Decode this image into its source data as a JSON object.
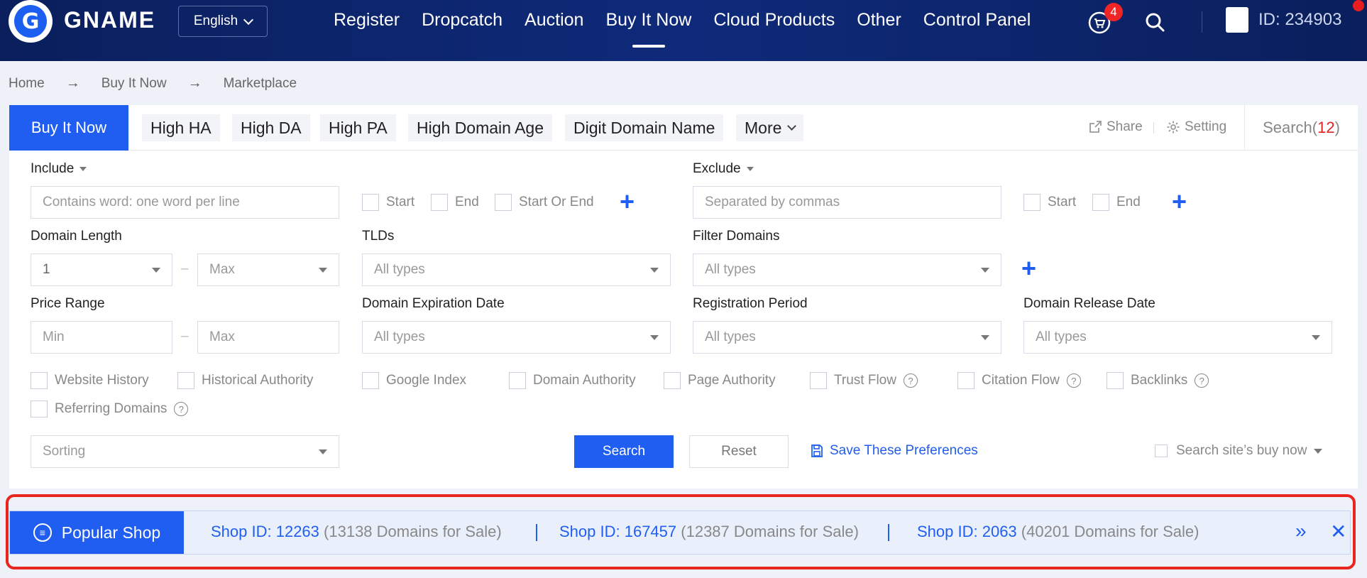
{
  "header": {
    "logo_letter": "G",
    "brand": "GNAME",
    "language": "English",
    "nav": [
      "Register",
      "Dropcatch",
      "Auction",
      "Buy It Now",
      "Cloud Products",
      "Other",
      "Control Panel"
    ],
    "cart_count": "4",
    "user_id": "ID: 234903"
  },
  "breadcrumb": [
    "Home",
    "Buy It Now",
    "Marketplace"
  ],
  "tabs": {
    "primary": "Buy It Now",
    "items": [
      "High HA",
      "High DA",
      "High PA",
      "High Domain Age",
      "Digit Domain Name",
      "More"
    ],
    "share": "Share",
    "setting": "Setting",
    "search_label": "Search(",
    "search_count": "12",
    "search_close": ")"
  },
  "filters": {
    "include_label": "Include",
    "include_placeholder": "Contains word: one word per line",
    "include_options": [
      "Start",
      "End",
      "Start Or End"
    ],
    "exclude_label": "Exclude",
    "exclude_placeholder": "Separated by commas",
    "exclude_options": [
      "Start",
      "End"
    ],
    "domain_length_label": "Domain Length",
    "domain_length_min": "1",
    "domain_length_max": "Max",
    "tlds_label": "TLDs",
    "tlds_value": "All types",
    "filter_domains_label": "Filter Domains",
    "filter_domains_value": "All types",
    "price_range_label": "Price Range",
    "price_min": "Min",
    "price_max": "Max",
    "expiration_label": "Domain Expiration Date",
    "expiration_value": "All types",
    "registration_label": "Registration Period",
    "registration_value": "All types",
    "release_label": "Domain Release Date",
    "release_value": "All types",
    "checkboxes": [
      "Website History",
      "Historical Authority",
      "Google Index",
      "Domain Authority",
      "Page Authority",
      "Trust Flow",
      "Citation Flow",
      "Backlinks",
      "Referring Domains"
    ],
    "sorting": "Sorting",
    "search_button": "Search",
    "reset_button": "Reset",
    "save_preferences": "Save These Preferences",
    "site_buy_now": "Search site’s buy now"
  },
  "popular_shop": {
    "label": "Popular Shop",
    "shops": [
      {
        "id": "Shop ID: 12263",
        "count": "(13138 Domains for Sale)"
      },
      {
        "id": "Shop ID: 167457",
        "count": "(12387 Domains for Sale)"
      },
      {
        "id": "Shop ID: 2063",
        "count": "(40201 Domains for Sale)"
      }
    ]
  },
  "colors": {
    "header_bg": "#0f2a7a",
    "accent": "#1f5ef0",
    "badge": "#f02525",
    "highlight_outline": "#e8251f"
  }
}
